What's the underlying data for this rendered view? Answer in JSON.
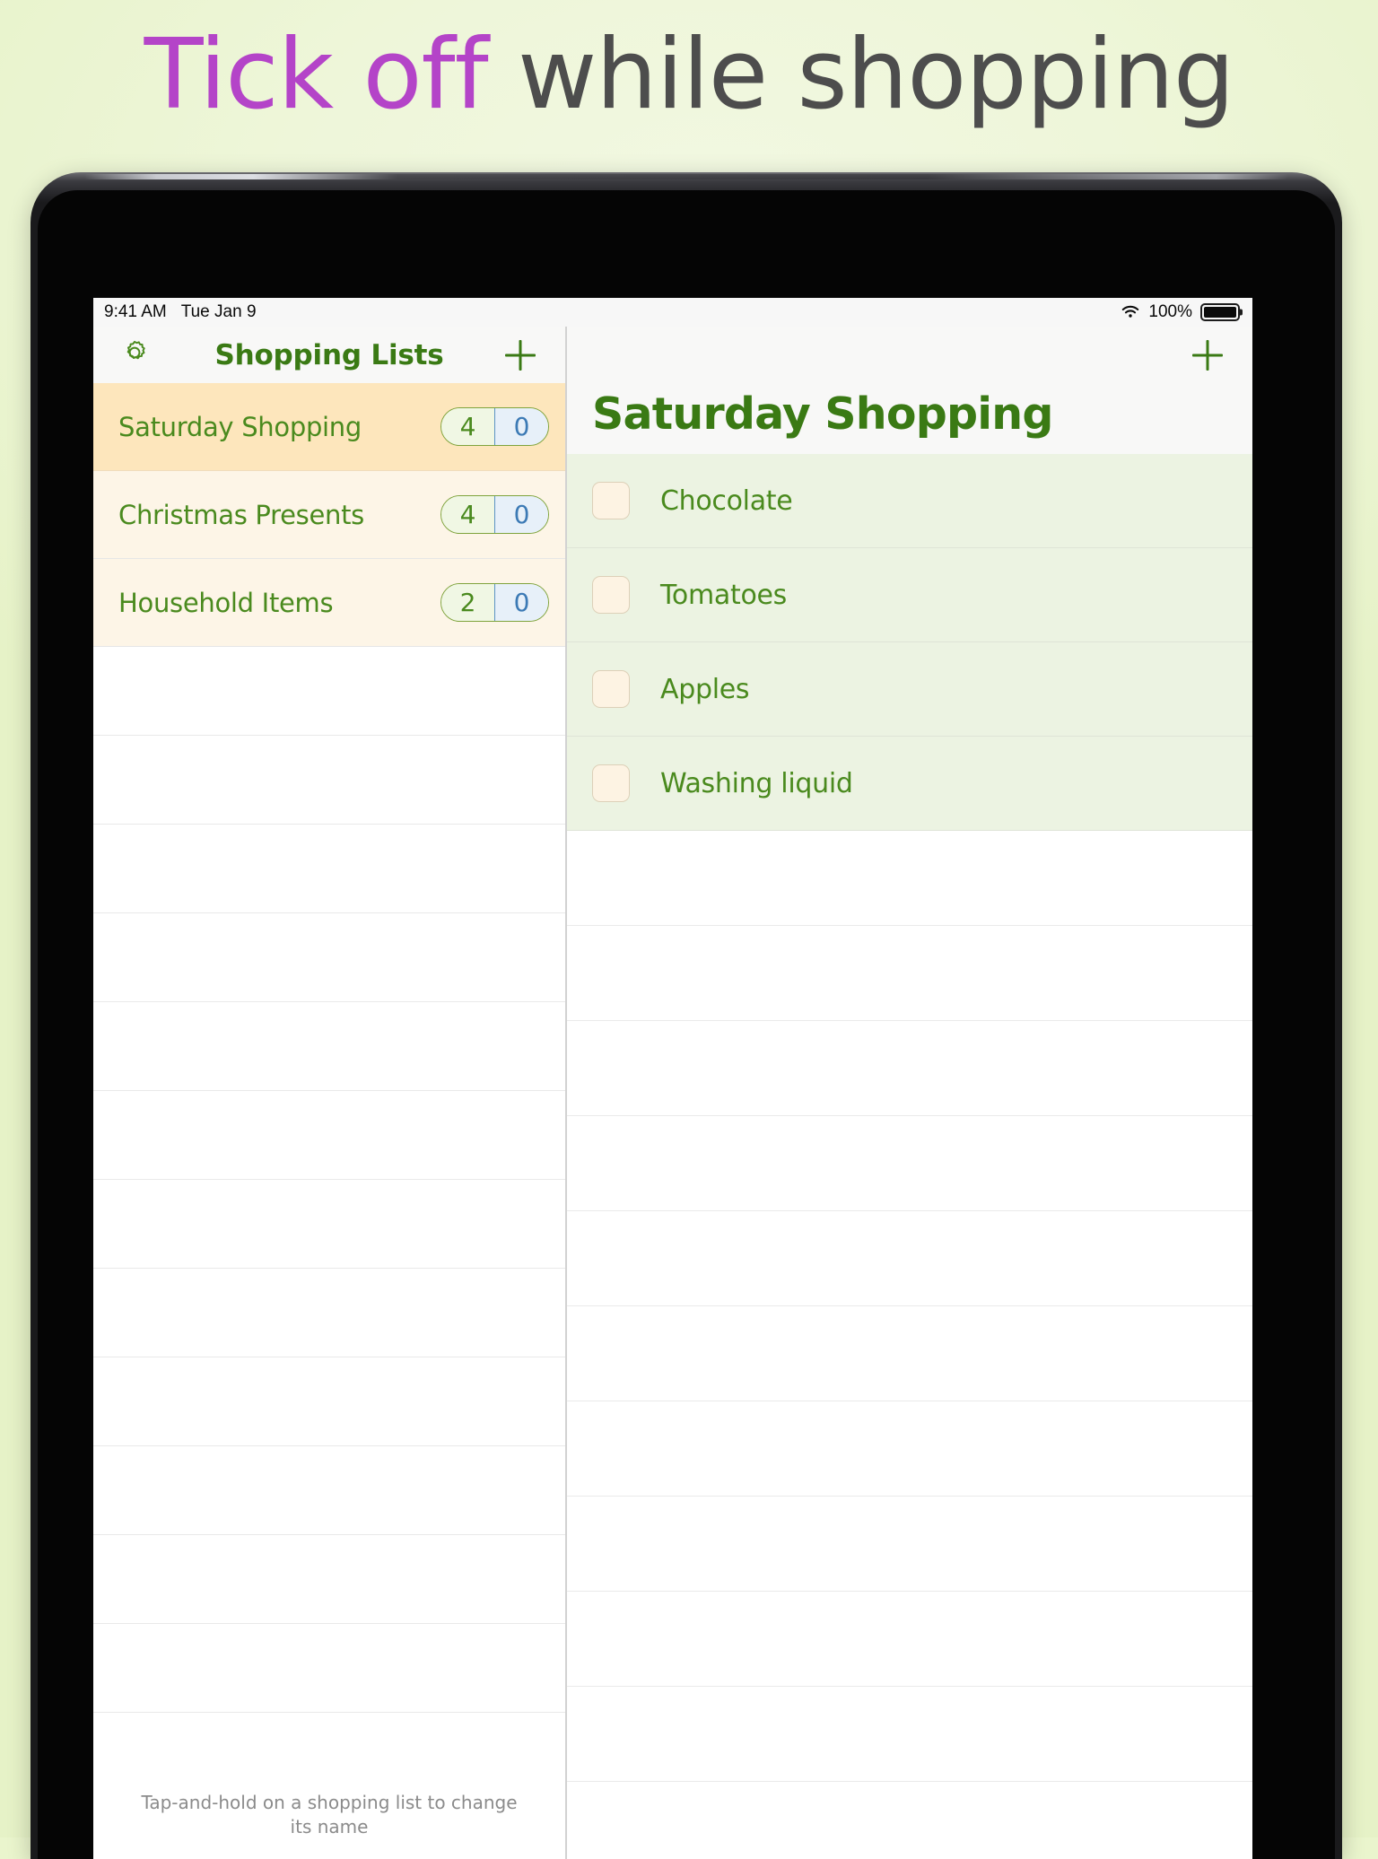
{
  "headline": {
    "accent_text": "Tick off",
    "rest_text": " while shopping",
    "accent_color": "#b444c8",
    "text_color": "#4d4d4d"
  },
  "status_bar": {
    "time": "9:41 AM",
    "date": "Tue Jan 9",
    "wifi_icon": "wifi-icon",
    "battery_percent": "100%",
    "battery_icon": "battery-full-icon"
  },
  "left_pane": {
    "navbar": {
      "settings_icon": "gear-icon",
      "title": "Shopping Lists",
      "add_icon": "plus-icon"
    },
    "lists": [
      {
        "name": "Saturday Shopping",
        "remaining": "4",
        "done": "0",
        "selected": true
      },
      {
        "name": "Christmas Presents",
        "remaining": "4",
        "done": "0",
        "selected": false
      },
      {
        "name": "Household Items",
        "remaining": "2",
        "done": "0",
        "selected": false
      }
    ],
    "empty_row_count": 12,
    "footer_hint": "Tap-and-hold on a shopping list to change its name"
  },
  "right_pane": {
    "navbar": {
      "add_icon": "plus-icon"
    },
    "title": "Saturday Shopping",
    "items": [
      {
        "name": "Chocolate",
        "checked": false
      },
      {
        "name": "Tomatoes",
        "checked": false
      },
      {
        "name": "Apples",
        "checked": false
      },
      {
        "name": "Washing liquid",
        "checked": false
      }
    ],
    "empty_row_count": 10
  },
  "colors": {
    "brand_green": "#3a7a14",
    "item_green": "#4a8a1e",
    "selected_row": "#fde6bc",
    "alt_row": "#fdf5e7",
    "item_row": "#ecf3e2",
    "checkbox_fill": "#fdf3e3",
    "badge_blue": "#3c7ab5",
    "page_bg": "#eef6d9"
  }
}
